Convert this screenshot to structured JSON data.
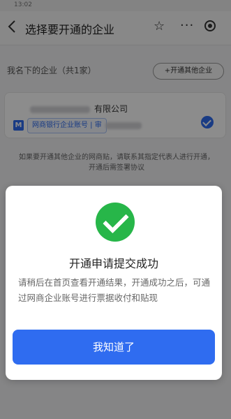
{
  "status_bar": {
    "time": "13:02",
    "right": ""
  },
  "header": {
    "back_glyph": "‹",
    "title": "选择要开通的企业",
    "star_glyph": "☆",
    "more_glyph": "···"
  },
  "list": {
    "section_label": "我名下的企业（共1家）",
    "open_other_button": "+开通其他企业",
    "company_name_suffix": "有限公司",
    "account_badge_logo": "M",
    "account_badge_text": "网商银行企业账号 | 审"
  },
  "note": "如果要开通其他企业的网商贴，请联系其指定代表人进行开通，开通后需签署协议",
  "dialog": {
    "title": "开通申请提交成功",
    "message": "请稍后在首页查看开通结果，开通成功之后，可通过网商企业账号进行票据收付和贴现",
    "confirm_button": "我知道了"
  },
  "colors": {
    "primary": "#2f6cf0",
    "success": "#27b649"
  }
}
